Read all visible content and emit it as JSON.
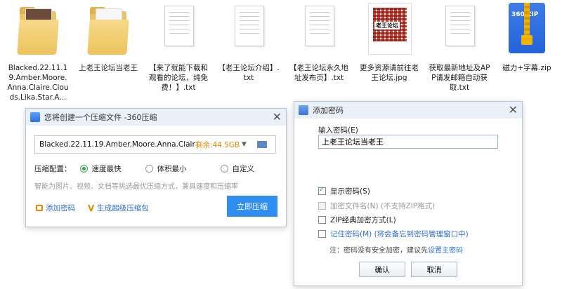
{
  "files": [
    {
      "name": "Blacked.22.11.19.Amber.Moore.Anna.Claire.Clouds.Lika.Star.A...",
      "icon": "folder-icon"
    },
    {
      "name": "上老王论坛当老王",
      "icon": "folder-icon"
    },
    {
      "name": "【来了就能下载和观看的论坛，纯免费！】.txt",
      "icon": "text-file-icon"
    },
    {
      "name": "【老王论坛介绍】.txt",
      "icon": "text-file-icon"
    },
    {
      "name": "【老王论坛永久地址发布页】.txt",
      "icon": "text-file-icon"
    },
    {
      "name": "更多资源请前往老王论坛.jpg",
      "icon": "qr-image-icon",
      "image_text": "老王论坛"
    },
    {
      "name": "获取最新地址及APP请发邮箱自动获取.txt",
      "icon": "text-file-icon"
    },
    {
      "name": "磁力+字幕.zip",
      "icon": "zip-archive-icon",
      "image_text": "360 ZIP"
    }
  ],
  "compress_dialog": {
    "title": "您将创建一个压缩文件 -360压缩",
    "close": "✕",
    "path_value": "Blacked.22.11.19.Amber.Moore.Anna.Clair",
    "free_space": "剩余:44.5GB",
    "config_label": "压缩配置：",
    "options": [
      "速度最快",
      "体积最小",
      "自定义"
    ],
    "selected_option": "速度最快",
    "hint": "智能为图片、视频、文档等挑选最优压缩方式，兼具速度和压缩率",
    "add_password": "添加密码",
    "super_package": "生成超级压缩包",
    "compress_button": "立即压缩"
  },
  "password_dialog": {
    "title": "添加密码",
    "close": "✕",
    "input_label": "输入密码(E)",
    "input_value": "上老王论坛当老王",
    "show_password": "显示密码(S)",
    "show_password_checked": true,
    "encrypt_filenames": "加密文件名(N) (不支持ZIP格式)",
    "zip_classic": "ZIP经典加密方式(L)",
    "remember_password": "记住密码(M) (将会备忘到密码管理窗口中)",
    "note_prefix": "注：密码没有安全加密，建议先",
    "note_link": "设置主密码",
    "ok_button": "确认",
    "cancel_button": "取消"
  },
  "colors": {
    "accent": "#2f8ef0",
    "free_space": "#e08a00",
    "check": "#35a853"
  }
}
